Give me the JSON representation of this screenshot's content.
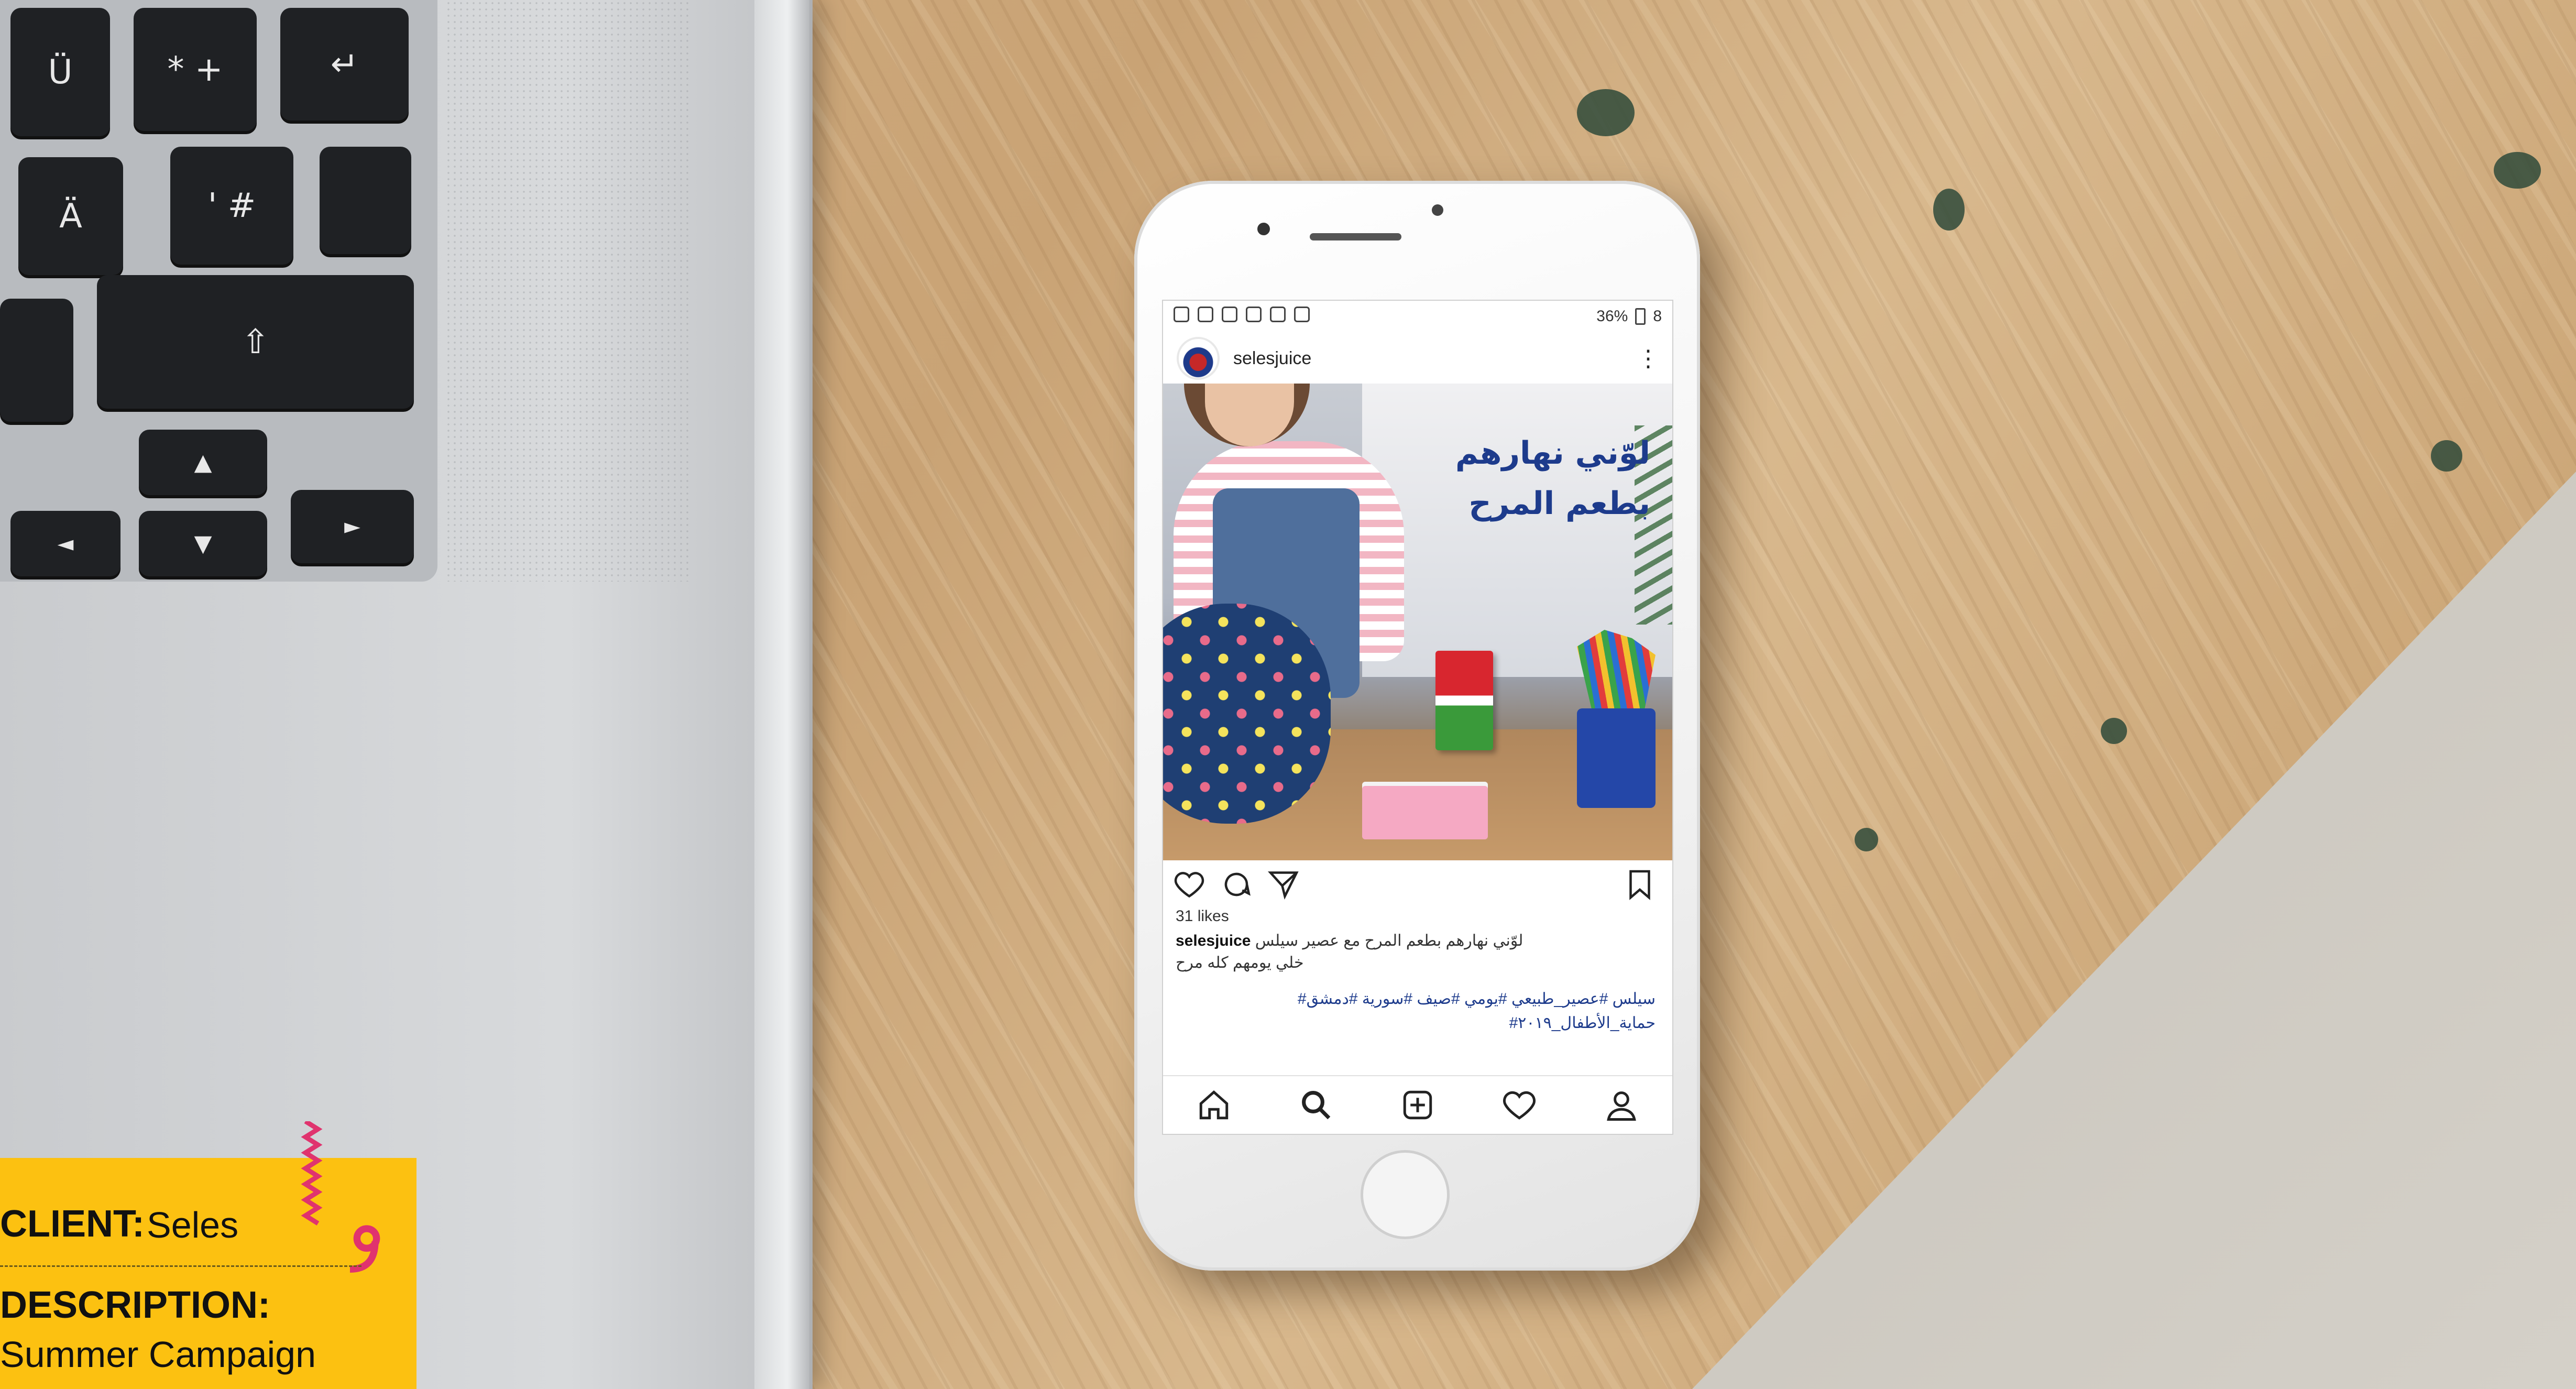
{
  "scene": {
    "colors": {
      "desk": "#c9a77d",
      "laptop": "#d8dadc",
      "card": "#fcc111",
      "accent_pink": "#e0336e",
      "headline_blue": "#1d3b8c"
    }
  },
  "laptop_keys": [
    {
      "name": "key-u-umlaut",
      "label": "Ü"
    },
    {
      "name": "key-asterisk-plus",
      "label": "* +"
    },
    {
      "name": "key-enter",
      "label": "↵"
    },
    {
      "name": "key-a-umlaut",
      "label": "Ä"
    },
    {
      "name": "key-hash",
      "label": "' #"
    },
    {
      "name": "key-shift",
      "label": "⇧"
    },
    {
      "name": "key-arrow-up",
      "label": "▲"
    },
    {
      "name": "key-arrow-left",
      "label": "◄"
    },
    {
      "name": "key-arrow-down",
      "label": "▼"
    },
    {
      "name": "key-arrow-right",
      "label": "►"
    }
  ],
  "phone": {
    "status_bar": {
      "right_text": "36%",
      "clock_text": "8"
    },
    "post": {
      "username": "selesjuice",
      "more_label": "⋮",
      "headline_line1": "لوّني نهارهم",
      "headline_line2": "بطعم المرح",
      "likes": "31 likes",
      "caption_user": "selesjuice",
      "caption_text": "لوّني نهارهم بطعم المرح مع عصير سيلس",
      "caption_text_2": "خلي يومهم كله مرح",
      "hashtags_line1": "#سيلس #عصير_طبيعي #يومي #صيف #سورية #دمشق",
      "hashtags_line2": "#حماية_الأطفال_٢٠١٩"
    },
    "action_icons": [
      "heart-icon",
      "comment-icon",
      "share-icon",
      "bookmark-icon"
    ],
    "nav_icons": [
      "home-icon",
      "search-icon",
      "add-post-icon",
      "activity-heart-icon",
      "profile-icon"
    ]
  },
  "info_card": {
    "client_label": "CLIENT:",
    "client_value": "Seles",
    "description_label": "DESCRIPTION:",
    "description_value": "Summer Campaign"
  }
}
